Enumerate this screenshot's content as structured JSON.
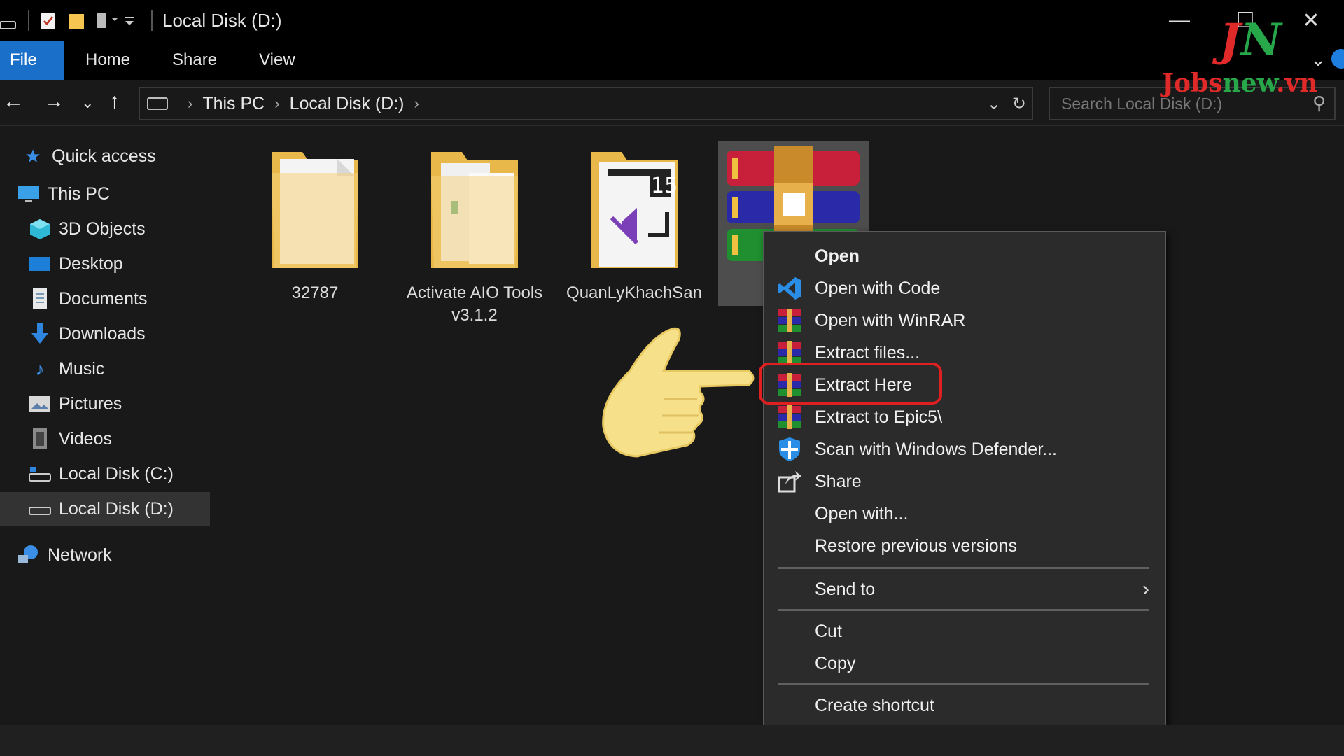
{
  "window": {
    "title": "Local Disk (D:)"
  },
  "ribbon": {
    "tabs": [
      "File",
      "Home",
      "Share",
      "View"
    ]
  },
  "address": {
    "crumbs": [
      "This PC",
      "Local Disk (D:)"
    ],
    "search_placeholder": "Search Local Disk (D:)"
  },
  "sidebar": {
    "items": [
      {
        "label": "Quick access",
        "icon": "star-icon"
      },
      {
        "label": "This PC",
        "icon": "computer-icon"
      },
      {
        "label": "3D Objects",
        "icon": "cube-icon"
      },
      {
        "label": "Desktop",
        "icon": "desktop-icon"
      },
      {
        "label": "Documents",
        "icon": "document-icon"
      },
      {
        "label": "Downloads",
        "icon": "download-arrow-icon"
      },
      {
        "label": "Music",
        "icon": "music-note-icon"
      },
      {
        "label": "Pictures",
        "icon": "picture-icon"
      },
      {
        "label": "Videos",
        "icon": "film-icon"
      },
      {
        "label": "Local Disk (C:)",
        "icon": "drive-icon"
      },
      {
        "label": "Local Disk (D:)",
        "icon": "drive-icon",
        "selected": true
      },
      {
        "label": "Network",
        "icon": "network-icon"
      }
    ]
  },
  "files": [
    {
      "name": "32787",
      "type": "folder"
    },
    {
      "name": "Activate AIO Tools v3.1.2",
      "type": "folder"
    },
    {
      "name": "QuanLyKhachSan",
      "type": "folder"
    },
    {
      "name": "",
      "type": "winrar-archive",
      "selected": true
    }
  ],
  "context_menu": {
    "items": [
      {
        "label": "Open",
        "bold": true
      },
      {
        "label": "Open with Code",
        "icon": "vscode-icon"
      },
      {
        "label": "Open with WinRAR",
        "icon": "winrar-icon"
      },
      {
        "label": "Extract files...",
        "icon": "winrar-icon"
      },
      {
        "label": "Extract Here",
        "icon": "winrar-icon",
        "highlighted": true
      },
      {
        "label": "Extract to Epic5\\",
        "icon": "winrar-icon"
      },
      {
        "label": "Scan with Windows Defender...",
        "icon": "defender-shield-icon"
      },
      {
        "label": "Share",
        "icon": "share-icon"
      },
      {
        "label": "Open with..."
      },
      {
        "label": "Restore previous versions"
      },
      {
        "label": "Send to",
        "submenu": true
      },
      {
        "label": "Cut"
      },
      {
        "label": "Copy"
      },
      {
        "label": "Create shortcut"
      }
    ]
  },
  "watermark": {
    "logo_letters": "JN",
    "site_red": "Jobs",
    "site_green": "new",
    "site_tail": ".vn"
  },
  "colors": {
    "accent": "#1a6fc9",
    "highlight_ring": "#e02020",
    "logo_red": "#e02a2a",
    "logo_green": "#27a64a"
  }
}
